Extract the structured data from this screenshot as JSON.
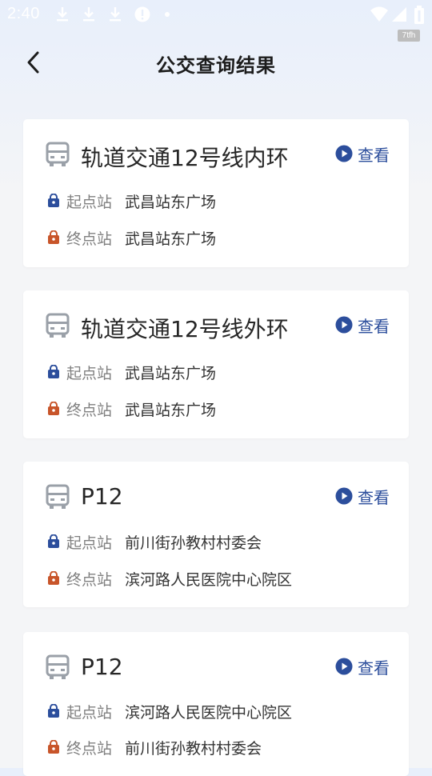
{
  "status_bar": {
    "time": "2:40",
    "badge": "7tfh"
  },
  "header": {
    "title": "公交查询结果"
  },
  "routes": [
    {
      "name": "轨道交通12号线内环",
      "view_label": "查看",
      "start_label": "起点站",
      "start_stop": "武昌站东广场",
      "end_label": "终点站",
      "end_stop": "武昌站东广场"
    },
    {
      "name": "轨道交通12号线外环",
      "view_label": "查看",
      "start_label": "起点站",
      "start_stop": "武昌站东广场",
      "end_label": "终点站",
      "end_stop": "武昌站东广场"
    },
    {
      "name": "P12",
      "view_label": "查看",
      "start_label": "起点站",
      "start_stop": "前川街孙教村村委会",
      "end_label": "终点站",
      "end_stop": "滨河路人民医院中心院区"
    },
    {
      "name": "P12",
      "view_label": "查看",
      "start_label": "起点站",
      "start_stop": "滨河路人民医院中心院区",
      "end_label": "终点站",
      "end_stop": "前川街孙教村村委会"
    }
  ],
  "colors": {
    "accent_blue": "#2c4e9c",
    "start_icon": "#2c4e9c",
    "end_icon": "#c8552a",
    "bus_icon": "#9aa0a8"
  },
  "icons": {
    "back": "chevron-left-icon",
    "bus": "bus-icon",
    "play": "play-circle-icon",
    "start": "start-lock-icon",
    "end": "end-lock-icon"
  }
}
